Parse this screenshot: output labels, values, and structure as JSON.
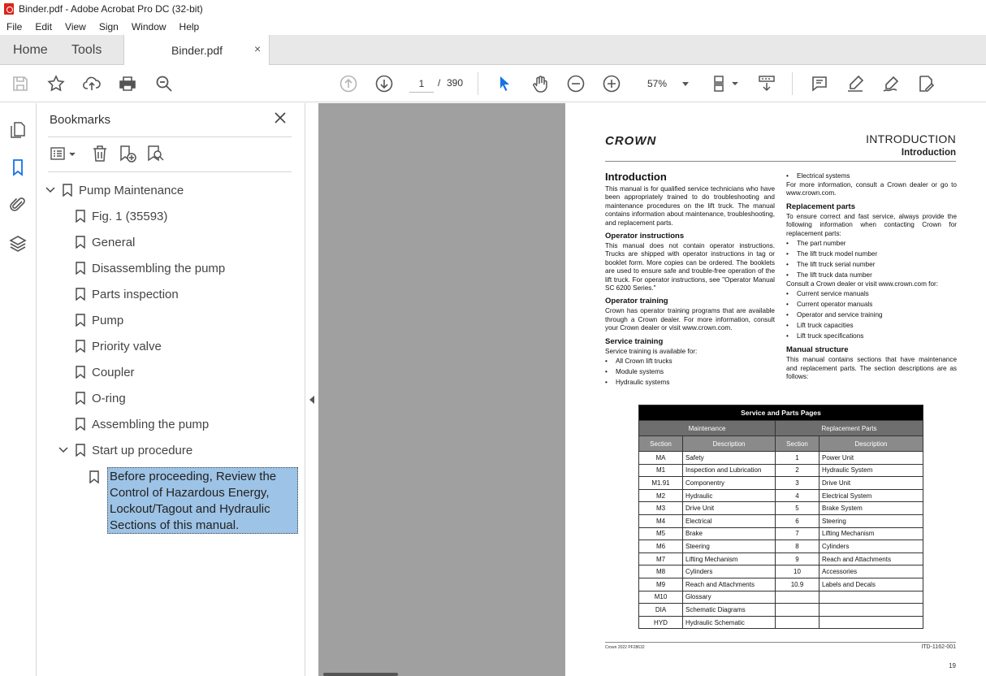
{
  "window": {
    "title": "Binder.pdf - Adobe Acrobat Pro DC (32-bit)"
  },
  "menu": [
    "File",
    "Edit",
    "View",
    "Sign",
    "Window",
    "Help"
  ],
  "tabs": {
    "home": "Home",
    "tools": "Tools",
    "document": "Binder.pdf",
    "close": "×"
  },
  "toolbar": {
    "page_current": "1",
    "page_sep": "/",
    "page_total": "390",
    "zoom": "57%"
  },
  "bookmarks": {
    "title": "Bookmarks",
    "items": [
      {
        "label": "Pump Maintenance"
      },
      {
        "label": "Fig. 1 (35593)"
      },
      {
        "label": "General"
      },
      {
        "label": "Disassembling the pump"
      },
      {
        "label": "Parts inspection"
      },
      {
        "label": "Pump"
      },
      {
        "label": "Priority valve"
      },
      {
        "label": "Coupler"
      },
      {
        "label": "O-ring"
      },
      {
        "label": "Assembling the pump"
      },
      {
        "label": "Start up procedure"
      }
    ],
    "selected": "Before proceeding, Review the Control of Hazardous Energy, Lockout/Tagout and Hydraulic Sections of this manual."
  },
  "pdf": {
    "logo": "CROWN",
    "header_title": "INTRODUCTION",
    "header_sub": "Introduction",
    "left": {
      "h_intro": "Introduction",
      "p_intro": "This manual is for qualified service technicians who have been appropriately trained to do troubleshooting and maintenance procedures on the lift truck. The manual contains information about maintenance, troubleshooting, and replacement parts.",
      "h_opinstr": "Operator instructions",
      "p_opinstr": "This manual does not contain operator instructions. Trucks are shipped with operator instructions in tag or booklet form. More copies can be ordered. The booklets are used to ensure safe and trouble-free operation of the lift truck. For operator instructions, see \"Operator Manual SC 6200 Series.\"",
      "h_optrain": "Operator training",
      "p_optrain": "Crown has operator training programs that are available through a Crown dealer. For more information, consult your Crown dealer or visit www.crown.com.",
      "h_svctrain": "Service training",
      "p_svctrain": "Service training is available for:",
      "svc_list": [
        "All Crown lift trucks",
        "Module systems",
        "Hydraulic systems"
      ]
    },
    "right": {
      "elec": "Electrical systems",
      "p_more": "For more information, consult a Crown dealer or go to www.crown.com.",
      "h_repl": "Replacement parts",
      "p_repl": "To ensure correct and fast service, always provide the following information when contacting Crown for replacement parts:",
      "repl_list": [
        "The part number",
        "The lift truck model number",
        "The lift truck serial number",
        "The lift truck data number"
      ],
      "p_consult": "Consult a Crown dealer or visit www.crown.com for:",
      "consult_list": [
        "Current service manuals",
        "Current operator manuals",
        "Operator and service training",
        "Lift truck capacities",
        "Lift truck specifications"
      ],
      "h_struct": "Manual structure",
      "p_struct": "This manual contains sections that have maintenance and replacement parts. The section descriptions are as follows:"
    },
    "table": {
      "title": "Service and Parts Pages",
      "group_maint": "Maintenance",
      "group_repl": "Replacement Parts",
      "col_section": "Section",
      "col_desc": "Description",
      "rows": [
        [
          "MA",
          "Safety",
          "1",
          "Power Unit"
        ],
        [
          "M1",
          "Inspection and Lubrication",
          "2",
          "Hydraulic System"
        ],
        [
          "M1.91",
          "Componentry",
          "3",
          "Drive Unit"
        ],
        [
          "M2",
          "Hydraulic",
          "4",
          "Electrical System"
        ],
        [
          "M3",
          "Drive Unit",
          "5",
          "Brake System"
        ],
        [
          "M4",
          "Electrical",
          "6",
          "Steering"
        ],
        [
          "M5",
          "Brake",
          "7",
          "Lifting Mechanism"
        ],
        [
          "M6",
          "Steering",
          "8",
          "Cylinders"
        ],
        [
          "M7",
          "Lifting Mechanism",
          "9",
          "Reach and Attachments"
        ],
        [
          "M8",
          "Cylinders",
          "10",
          "Accessories"
        ],
        [
          "M9",
          "Reach and Attachments",
          "10.9",
          "Labels and Decals"
        ],
        [
          "M10",
          "Glossary",
          "",
          ""
        ],
        [
          "DIA",
          "Schematic Diagrams",
          "",
          ""
        ],
        [
          "HYD",
          "Hydraulic Schematic",
          "",
          ""
        ]
      ]
    },
    "footer_left": "Crown 2022 PF28632",
    "footer_right": "ITD-1162-001",
    "page_number": "19"
  }
}
